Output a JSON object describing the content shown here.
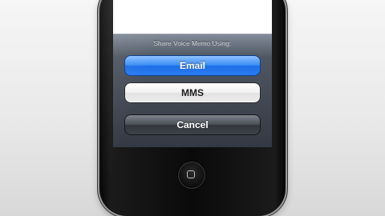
{
  "action_sheet": {
    "title": "Share Voice Memo Using:",
    "buttons": {
      "email": "Email",
      "mms": "MMS",
      "cancel": "Cancel"
    }
  },
  "colors": {
    "email_button": "#2a7bf0",
    "sheet_background": "#2d323c",
    "background": "#ececec"
  },
  "icons": {
    "home": "home-square-icon"
  }
}
